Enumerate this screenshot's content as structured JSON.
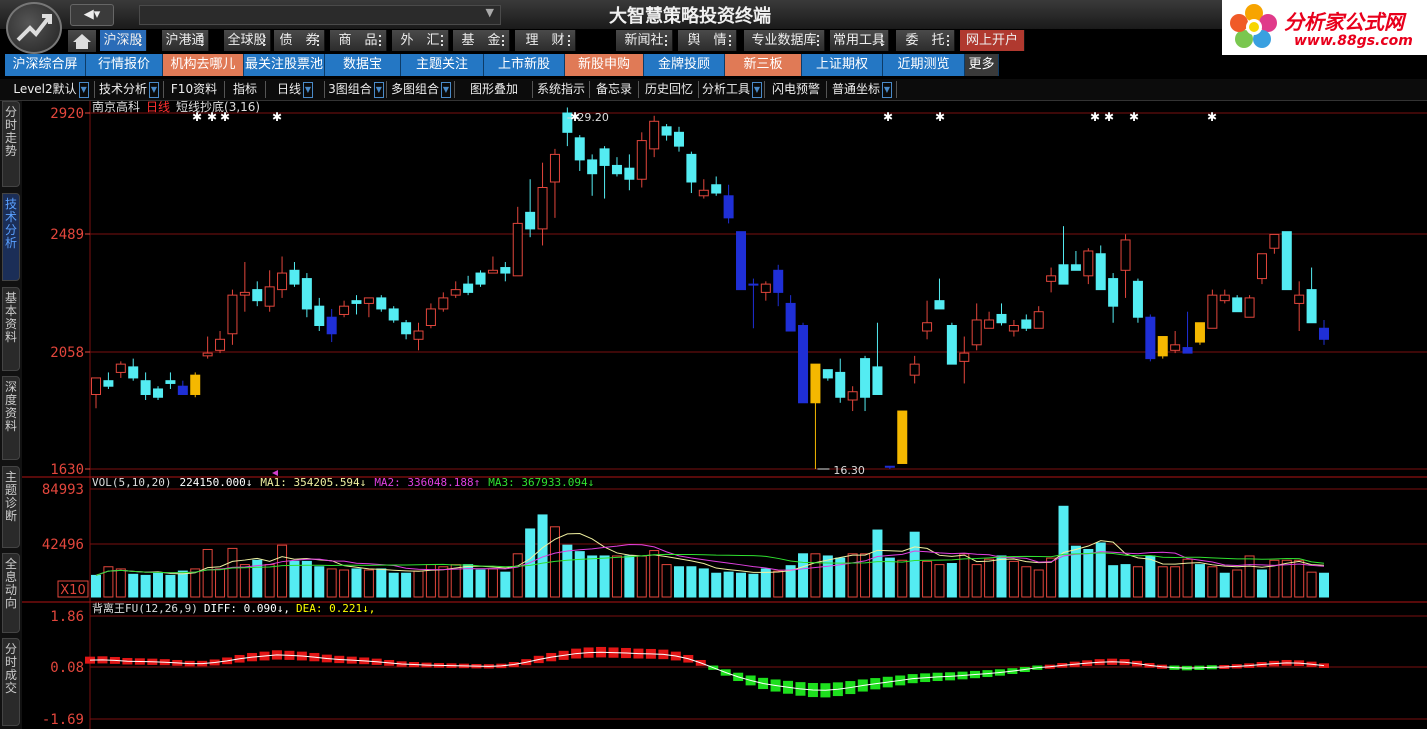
{
  "title_bar": {
    "app_title": "大智慧策略投资终端"
  },
  "brand": {
    "line1": "分析家公式网",
    "line2": "www.88gs.com"
  },
  "menu_row1": [
    {
      "label": "沪深股",
      "style": "blue"
    },
    {
      "label": "沪港通"
    },
    {
      "label": "全球股"
    },
    {
      "label": "债　券"
    },
    {
      "label": "商　品"
    },
    {
      "label": "外　汇"
    },
    {
      "label": "基　金"
    },
    {
      "label": "理　财"
    },
    {
      "label": "新闻社"
    },
    {
      "label": "舆　情"
    },
    {
      "label": "专业数据库"
    },
    {
      "label": "常用工具"
    },
    {
      "label": "委　托"
    },
    {
      "label": "网上开户",
      "style": "red"
    }
  ],
  "menu_row2": [
    {
      "label": "沪深综合屏"
    },
    {
      "label": "行情报价"
    },
    {
      "label": "机构去哪儿",
      "style": "sel"
    },
    {
      "label": "最关注股票池"
    },
    {
      "label": "数据宝"
    },
    {
      "label": "主题关注"
    },
    {
      "label": "上市新股"
    },
    {
      "label": "新股申购",
      "style": "sel"
    },
    {
      "label": "金牌投顾"
    },
    {
      "label": "新三板",
      "style": "sel"
    },
    {
      "label": "上证期权"
    },
    {
      "label": "近期测览"
    },
    {
      "label": "更多",
      "style": "more"
    }
  ],
  "toolbar": [
    "Level2默认",
    "技术分析",
    "F10资料",
    "指标",
    "日线",
    "3图组合",
    "多图组合",
    "图形叠加",
    "系统指示",
    "备忘录",
    "历史回忆",
    "分析工具",
    "闪电预警",
    "普通坐标"
  ],
  "sidebar_tabs": [
    "分时走势",
    "技术分析",
    "基本资料",
    "深度资料",
    "主题诊断",
    "全息动向",
    "分时成交"
  ],
  "main_chart": {
    "stock_name": "南京高科",
    "period": "日线",
    "indicator": "短线抄底(3,16)",
    "y_labels": [
      "2920",
      "2489",
      "2058",
      "1630"
    ],
    "high_mark": "29.20",
    "low_mark": "16.30"
  },
  "vol_panel": {
    "label": "VOL(5,10,20)",
    "vol": "224150.000↓",
    "ma1": "MA1: 354205.594↓",
    "ma2": "MA2: 336048.188↑",
    "ma3": "MA3: 367933.094↓",
    "y_labels": [
      "84993",
      "42496"
    ],
    "unit": "X10"
  },
  "macd_panel": {
    "label": "背离王FU(12,26,9)",
    "diff": "DIFF: 0.090↓,",
    "dea": "DEA: 0.221↓,",
    "y_labels": [
      "1.86",
      "0.08",
      "-1.69"
    ]
  },
  "colors": {
    "up": "#e2463c",
    "down": "#54ecf2",
    "blue": "#1f2fd6",
    "yellow": "#f5b800",
    "grid": "#7a0f0f",
    "macd_red": "#e21616",
    "macd_green": "#1ddf1d"
  },
  "chart_data": {
    "type": "candlestick",
    "price_axis": {
      "min": 16.3,
      "max": 29.2
    },
    "candles": [
      [
        "u",
        19,
        19.6,
        18.5,
        19.6
      ],
      [
        "d",
        19.5,
        19.8,
        19.2,
        19.3
      ],
      [
        "u",
        19.8,
        20.2,
        19.6,
        20.1
      ],
      [
        "d",
        20,
        20.3,
        19.5,
        19.6
      ],
      [
        "d",
        19.5,
        19.8,
        18.8,
        19
      ],
      [
        "d",
        19.2,
        19.3,
        18.8,
        18.9
      ],
      [
        "d",
        19.5,
        19.8,
        19.2,
        19.4
      ],
      [
        "b",
        19.3,
        19.5,
        19,
        19
      ],
      [
        "y",
        19,
        19.8,
        18.9,
        19.7
      ],
      [
        "u",
        20.4,
        21.1,
        20.3,
        20.5
      ],
      [
        "u",
        20.6,
        21.3,
        20.5,
        21
      ],
      [
        "u",
        21.2,
        22.8,
        20.8,
        22.6
      ],
      [
        "u",
        22.6,
        23.8,
        22,
        22.7
      ],
      [
        "d",
        22.8,
        23.1,
        22.2,
        22.4
      ],
      [
        "u",
        22.2,
        23.5,
        22,
        22.9
      ],
      [
        "u",
        22.8,
        24,
        22.5,
        23.4
      ],
      [
        "d",
        23.5,
        23.8,
        22.9,
        23
      ],
      [
        "d",
        23.2,
        23.4,
        21.8,
        22.1
      ],
      [
        "d",
        22.2,
        22.5,
        21.3,
        21.5
      ],
      [
        "b",
        21.8,
        22.1,
        20.9,
        21.2
      ],
      [
        "u",
        21.9,
        22.4,
        21.8,
        22.2
      ],
      [
        "d",
        22.4,
        22.6,
        21.9,
        22.3
      ],
      [
        "u",
        22.3,
        22.5,
        21.8,
        22.5
      ],
      [
        "d",
        22.5,
        22.6,
        22,
        22.1
      ],
      [
        "d",
        22.1,
        22.2,
        21.6,
        21.7
      ],
      [
        "d",
        21.6,
        21.7,
        21,
        21.2
      ],
      [
        "u",
        21,
        21.6,
        20.6,
        21.3
      ],
      [
        "u",
        21.5,
        22.3,
        21.4,
        22.1
      ],
      [
        "u",
        22.1,
        22.7,
        22,
        22.5
      ],
      [
        "u",
        22.6,
        23.1,
        22.5,
        22.8
      ],
      [
        "d",
        23,
        23.3,
        22.6,
        22.7
      ],
      [
        "d",
        23.4,
        23.5,
        22.9,
        23
      ],
      [
        "u",
        23.4,
        24,
        23.4,
        23.5
      ],
      [
        "d",
        23.6,
        23.8,
        23.1,
        23.4
      ],
      [
        "u",
        23.3,
        25.8,
        23.3,
        25.2
      ],
      [
        "d",
        25.6,
        26.8,
        24.7,
        25
      ],
      [
        "u",
        25,
        27.4,
        24.4,
        26.5
      ],
      [
        "u",
        26.7,
        27.9,
        25.4,
        27.7
      ],
      [
        "d",
        29.2,
        29.4,
        28,
        28.5
      ],
      [
        "d",
        28.3,
        28.4,
        27.1,
        27.5
      ],
      [
        "d",
        27.5,
        27.7,
        26.2,
        27
      ],
      [
        "d",
        27.9,
        28,
        26.1,
        27.3
      ],
      [
        "d",
        27.3,
        27.6,
        26.9,
        27
      ],
      [
        "d",
        27.2,
        27.7,
        26.4,
        26.8
      ],
      [
        "u",
        26.8,
        28.5,
        26.5,
        28.2
      ],
      [
        "u",
        27.9,
        29.1,
        27.6,
        28.9
      ],
      [
        "d",
        28.7,
        28.8,
        28.2,
        28.4
      ],
      [
        "d",
        28.5,
        28.7,
        27.8,
        28
      ],
      [
        "d",
        27.7,
        27.8,
        26.3,
        26.7
      ],
      [
        "u",
        26.2,
        26.8,
        26.1,
        26.4
      ],
      [
        "d",
        26.6,
        26.9,
        26.2,
        26.3
      ],
      [
        "b",
        26.2,
        26.6,
        25.2,
        25.4
      ],
      [
        "b",
        24.9,
        24.9,
        22.8,
        22.8
      ],
      [
        "b",
        23,
        23.2,
        21.4,
        23
      ],
      [
        "u",
        22.7,
        23.1,
        22.4,
        23
      ],
      [
        "b",
        23.5,
        23.7,
        22.2,
        22.7
      ],
      [
        "b",
        22.3,
        22.6,
        21.3,
        21.3
      ],
      [
        "b",
        21.5,
        21.6,
        18.7,
        18.7
      ],
      [
        "y",
        18.7,
        20.1,
        16.3,
        20.1
      ],
      [
        "d",
        19.9,
        19.9,
        19.5,
        19.6
      ],
      [
        "d",
        19.8,
        20.3,
        18.7,
        18.9
      ],
      [
        "u",
        18.8,
        19.3,
        18.4,
        19.1
      ],
      [
        "d",
        20.3,
        20.4,
        18.4,
        18.9
      ],
      [
        "d",
        20,
        21.6,
        19.9,
        19
      ],
      [
        "b",
        16.4,
        16.4,
        16.3,
        16.4
      ],
      [
        "y",
        16.5,
        18.4,
        16.5,
        18.4
      ],
      [
        "u",
        19.7,
        20.4,
        19.4,
        20.1
      ],
      [
        "u",
        21.3,
        22.4,
        21,
        21.6
      ],
      [
        "d",
        22.4,
        23.2,
        22.1,
        22.1
      ],
      [
        "d",
        21.5,
        21.6,
        20.1,
        20.1
      ],
      [
        "u",
        20.2,
        21.1,
        19.4,
        20.5
      ],
      [
        "u",
        20.8,
        22.3,
        20.6,
        21.7
      ],
      [
        "u",
        21.4,
        22,
        21.4,
        21.7
      ],
      [
        "d",
        21.9,
        22.3,
        21.5,
        21.6
      ],
      [
        "u",
        21.3,
        21.7,
        21.1,
        21.5
      ],
      [
        "d",
        21.7,
        21.9,
        21.3,
        21.4
      ],
      [
        "u",
        21.4,
        22.2,
        21.4,
        22
      ],
      [
        "u",
        23.1,
        23.6,
        22.7,
        23.3
      ],
      [
        "d",
        23.7,
        25.1,
        23,
        23
      ],
      [
        "d",
        23.7,
        24.2,
        23.6,
        23.5
      ],
      [
        "u",
        23.3,
        24.3,
        23,
        24.2
      ],
      [
        "d",
        24.1,
        24.4,
        22.9,
        22.8
      ],
      [
        "d",
        23.2,
        23.4,
        21.6,
        22.2
      ],
      [
        "u",
        24.6,
        24.8,
        22.5,
        23.5
      ],
      [
        "d",
        23.1,
        23.2,
        21.6,
        21.8
      ],
      [
        "b",
        21.8,
        21.9,
        20.2,
        20.3
      ],
      [
        "y",
        21.1,
        21.1,
        20.3,
        20.4
      ],
      [
        "u",
        20.8,
        21.3,
        20.5,
        20.6
      ],
      [
        "b",
        20.7,
        22,
        20.5,
        20.5
      ],
      [
        "y",
        20.9,
        20.9,
        20.8,
        21.6
      ],
      [
        "u",
        21.4,
        22.8,
        21.4,
        22.6
      ],
      [
        "u",
        22.4,
        22.8,
        22.3,
        22.6
      ],
      [
        "d",
        22.5,
        22.6,
        22,
        22
      ],
      [
        "u",
        21.8,
        22.6,
        21.8,
        22.5
      ],
      [
        "u",
        23.2,
        24.1,
        23,
        24.1
      ],
      [
        "u",
        24.3,
        24.6,
        24.1,
        24.8
      ],
      [
        "d",
        24.9,
        24.9,
        22.8,
        22.8
      ],
      [
        "u",
        22.3,
        23.1,
        21.3,
        22.6
      ],
      [
        "d",
        22.8,
        23.6,
        21.9,
        21.6
      ],
      [
        "b",
        21.4,
        21.7,
        20.8,
        21
      ]
    ],
    "volume": [
      [
        "d",
        0.2
      ],
      [
        "u",
        0.28
      ],
      [
        "u",
        0.26
      ],
      [
        "d",
        0.21
      ],
      [
        "d",
        0.2
      ],
      [
        "d",
        0.22
      ],
      [
        "d",
        0.2
      ],
      [
        "d",
        0.24
      ],
      [
        "u",
        0.26
      ],
      [
        "u",
        0.44
      ],
      [
        "u",
        0.26
      ],
      [
        "u",
        0.45
      ],
      [
        "u",
        0.3
      ],
      [
        "d",
        0.34
      ],
      [
        "u",
        0.3
      ],
      [
        "u",
        0.48
      ],
      [
        "d",
        0.33
      ],
      [
        "d",
        0.33
      ],
      [
        "d",
        0.28
      ],
      [
        "u",
        0.26
      ],
      [
        "u",
        0.25
      ],
      [
        "d",
        0.26
      ],
      [
        "u",
        0.25
      ],
      [
        "d",
        0.26
      ],
      [
        "d",
        0.22
      ],
      [
        "d",
        0.22
      ],
      [
        "u",
        0.24
      ],
      [
        "u",
        0.3
      ],
      [
        "u",
        0.28
      ],
      [
        "u",
        0.3
      ],
      [
        "d",
        0.3
      ],
      [
        "d",
        0.25
      ],
      [
        "u",
        0.26
      ],
      [
        "d",
        0.23
      ],
      [
        "u",
        0.4
      ],
      [
        "d",
        0.63
      ],
      [
        "d",
        0.76
      ],
      [
        "u",
        0.65
      ],
      [
        "d",
        0.48
      ],
      [
        "d",
        0.42
      ],
      [
        "d",
        0.38
      ],
      [
        "d",
        0.38
      ],
      [
        "u",
        0.38
      ],
      [
        "d",
        0.38
      ],
      [
        "u",
        0.38
      ],
      [
        "u",
        0.43
      ],
      [
        "u",
        0.3
      ],
      [
        "d",
        0.28
      ],
      [
        "d",
        0.28
      ],
      [
        "d",
        0.26
      ],
      [
        "d",
        0.22
      ],
      [
        "d",
        0.23
      ],
      [
        "d",
        0.22
      ],
      [
        "d",
        0.21
      ],
      [
        "d",
        0.26
      ],
      [
        "u",
        0.24
      ],
      [
        "d",
        0.29
      ],
      [
        "d",
        0.4
      ],
      [
        "u",
        0.4
      ],
      [
        "d",
        0.38
      ],
      [
        "d",
        0.36
      ],
      [
        "u",
        0.4
      ],
      [
        "u",
        0.4
      ],
      [
        "d",
        0.62
      ],
      [
        "d",
        0.36
      ],
      [
        "u",
        0.34
      ],
      [
        "d",
        0.6
      ],
      [
        "u",
        0.33
      ],
      [
        "u",
        0.3
      ],
      [
        "d",
        0.31
      ],
      [
        "u",
        0.4
      ],
      [
        "u",
        0.3
      ],
      [
        "u",
        0.35
      ],
      [
        "d",
        0.38
      ],
      [
        "u",
        0.33
      ],
      [
        "u",
        0.28
      ],
      [
        "u",
        0.25
      ],
      [
        "u",
        0.36
      ],
      [
        "d",
        0.84
      ],
      [
        "d",
        0.47
      ],
      [
        "d",
        0.44
      ],
      [
        "d",
        0.5
      ],
      [
        "d",
        0.29
      ],
      [
        "d",
        0.3
      ],
      [
        "u",
        0.28
      ],
      [
        "d",
        0.38
      ],
      [
        "u",
        0.28
      ],
      [
        "u",
        0.28
      ],
      [
        "u",
        0.35
      ],
      [
        "d",
        0.3
      ],
      [
        "u",
        0.28
      ],
      [
        "d",
        0.22
      ],
      [
        "u",
        0.25
      ],
      [
        "u",
        0.38
      ],
      [
        "d",
        0.25
      ],
      [
        "u",
        0.34
      ],
      [
        "u",
        0.34
      ],
      [
        "u",
        0.34
      ],
      [
        "u",
        0.23
      ],
      [
        "d",
        0.22
      ]
    ],
    "macd": [
      0.5,
      0.52,
      0.48,
      0.42,
      0.4,
      0.38,
      0.35,
      0.3,
      0.25,
      0.25,
      0.33,
      0.45,
      0.6,
      0.72,
      0.8,
      0.88,
      0.85,
      0.8,
      0.72,
      0.62,
      0.55,
      0.5,
      0.45,
      0.38,
      0.3,
      0.22,
      0.18,
      0.14,
      0.12,
      0.1,
      0.08,
      0.06,
      0.05,
      0.08,
      0.18,
      0.35,
      0.55,
      0.72,
      0.85,
      0.98,
      1.05,
      1.08,
      1.05,
      1.02,
      0.98,
      0.96,
      0.92,
      0.8,
      0.6,
      0.3,
      -0.05,
      -0.4,
      -0.72,
      -0.98,
      -1.2,
      -1.35,
      -1.48,
      -1.6,
      -1.68,
      -1.7,
      -1.62,
      -1.5,
      -1.35,
      -1.22,
      -1.1,
      -0.98,
      -0.85,
      -0.78,
      -0.72,
      -0.68,
      -0.62,
      -0.55,
      -0.48,
      -0.4,
      -0.3,
      -0.18,
      -0.05,
      0.02,
      0.12,
      0.2,
      0.28,
      0.35,
      0.38,
      0.35,
      0.25,
      0.12,
      0.02,
      -0.05,
      -0.08,
      -0.06,
      -0.02,
      0.0,
      0.05,
      0.1,
      0.18,
      0.25,
      0.3,
      0.28,
      0.2,
      0.1
    ],
    "signal_stars_x": [
      175,
      190,
      203,
      255,
      553,
      866,
      918,
      1073,
      1087,
      1112,
      1190
    ]
  }
}
